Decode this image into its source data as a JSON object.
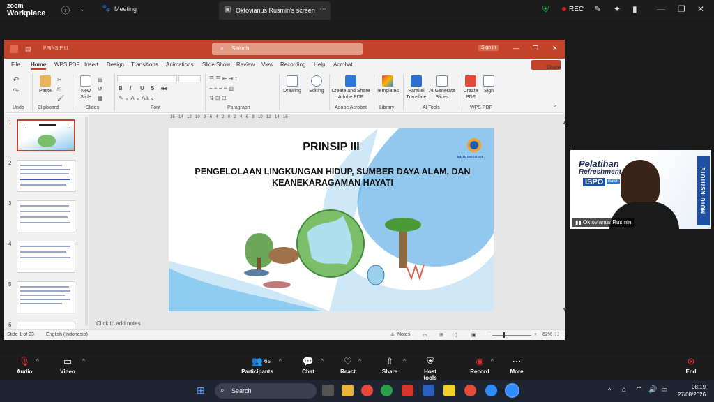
{
  "zoom": {
    "brand_line1": "zoom",
    "brand_line2": "Workplace",
    "meeting_label": "Meeting",
    "screen_tab": "Oktovianus Rusmin's screen",
    "rec_label": "REC"
  },
  "ppt": {
    "doc_name": "PRINSIP III",
    "search_placeholder": "Search",
    "signin": "Sign in",
    "menu": [
      "File",
      "Home",
      "WPS PDF",
      "Insert",
      "Design",
      "Transitions",
      "Animations",
      "Slide Show",
      "Review",
      "View",
      "Recording",
      "Help",
      "Acrobat"
    ],
    "share": "Share",
    "ribbon": {
      "undo": "Undo",
      "paste": "Paste",
      "clipboard": "Clipboard",
      "new_slide": "New Slide",
      "slides": "Slides",
      "font": "Font",
      "paragraph": "Paragraph",
      "drawing": "Drawing",
      "editing": "Editing",
      "create_share": "Create and Share Adobe PDF",
      "adobe_acrobat": "Adobe Acrobat",
      "templates": "Templates",
      "library": "Library",
      "parallel_translate": "Parallel Translate",
      "ai_generate": "AI Generate Slides",
      "ai_tools": "AI Tools",
      "create_pdf": "Create PDF",
      "sign": "Sign",
      "wps_pdf": "WPS PDF",
      "fmt_b": "B",
      "fmt_i": "I",
      "fmt_u": "U",
      "fmt_s": "S",
      "fmt_ab": "ab"
    },
    "thumb_numbers": [
      "1",
      "2",
      "3",
      "4",
      "5",
      "6"
    ],
    "slide": {
      "title": "PRINSIP III",
      "subtitle": "PENGELOLAAN LINGKUNGAN HIDUP, SUMBER DAYA ALAM, DAN KEANEKARAGAMAN HAYATI",
      "logo_text": "MUTU INSTITUTE"
    },
    "notes_placeholder": "Click to add notes",
    "status": {
      "slide_count": "Slide 1 of 23",
      "language": "English (Indonesia)",
      "notes": "Notes",
      "zoom": "62%"
    },
    "ruler": "16 · 14 · 12 · 10 · 8 · 6 · 4 · 2 · 0 · 2 · 4 · 6 · 8 · 10 · 12 · 14 · 16"
  },
  "participant": {
    "name": "Oktovianus Rusmin",
    "bg_text1": "Pelatihan",
    "bg_text2": "Refreshment",
    "bg_text3": "ISPO",
    "bg_text4": "Batch",
    "side_text": "MUTU INSTITUTE"
  },
  "controls": {
    "audio": "Audio",
    "video": "Video",
    "participants": "Participants",
    "participants_count": "65",
    "chat": "Chat",
    "react": "React",
    "share": "Share",
    "host_tools": "Host tools",
    "record": "Record",
    "more": "More",
    "end": "End"
  },
  "taskbar": {
    "search": "Search",
    "time": "08:19",
    "date": "27/08/2026"
  },
  "colors": {
    "ppt_accent": "#c3422a",
    "zoom_bg": "#1c1c1c",
    "rec": "#e02020",
    "taskbar": "#1f2530"
  }
}
